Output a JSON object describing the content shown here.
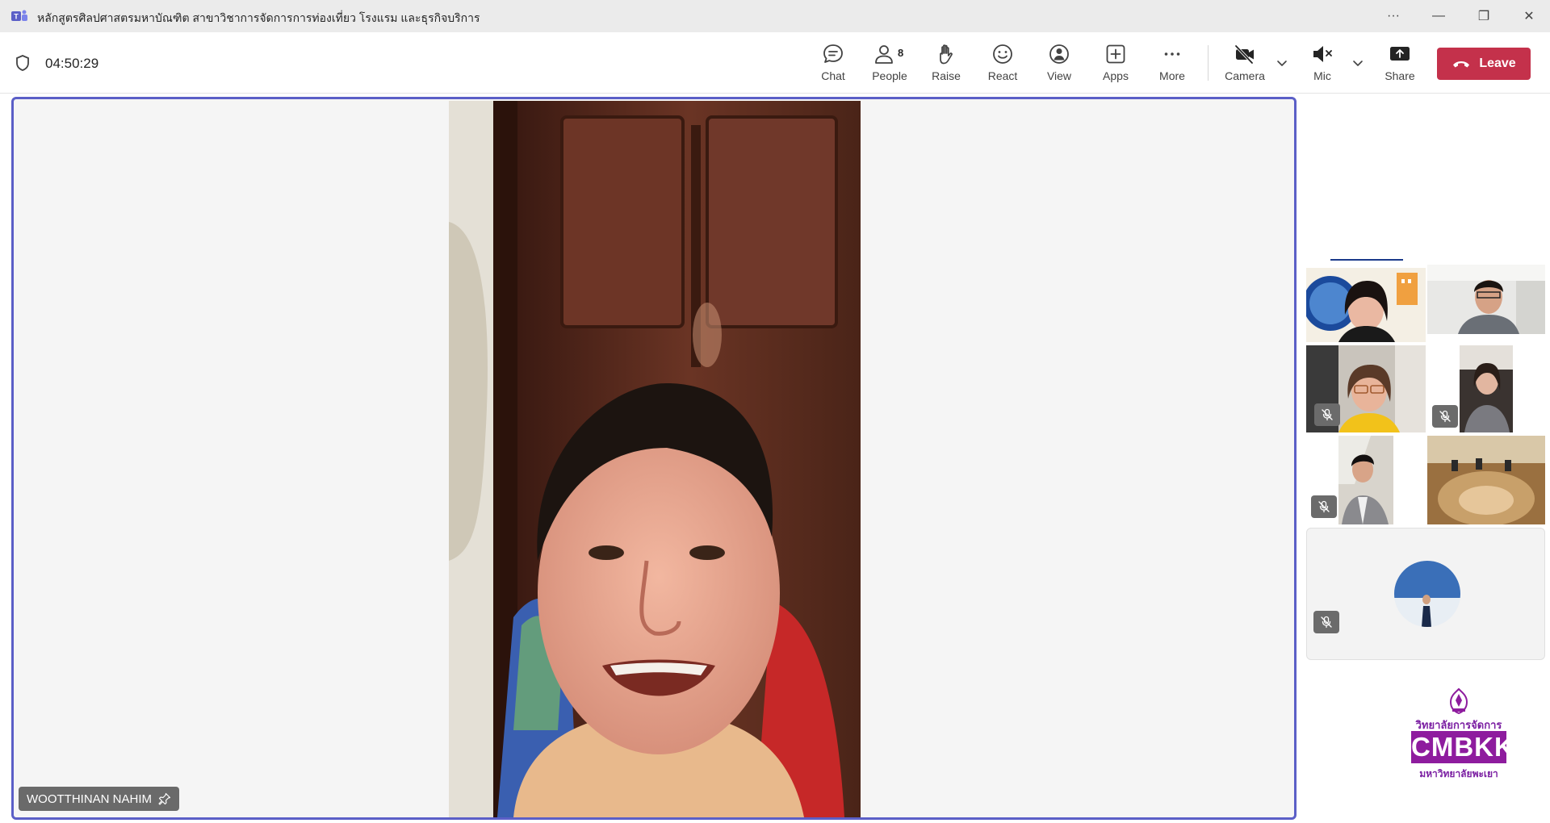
{
  "window": {
    "title": "หลักสูตรศิลปศาสตรมหาบัณฑิต สาขาวิชาการจัดการการท่องเที่ยว โรงแรม และธุรกิจบริการ",
    "more_label": "···",
    "minimize_label": "—",
    "restore_label": "❐",
    "close_label": "✕"
  },
  "toolbar": {
    "timer": "04:50:29",
    "chat_label": "Chat",
    "people_label": "People",
    "people_count": "8",
    "raise_label": "Raise",
    "react_label": "React",
    "view_label": "View",
    "apps_label": "Apps",
    "more_label": "More",
    "camera_label": "Camera",
    "mic_label": "Mic",
    "share_label": "Share",
    "leave_label": "Leave"
  },
  "stage": {
    "speaker_name": "WOOTTHINAN NAHIM"
  },
  "logo": {
    "line1": "วิทยาลัยการจัดการ",
    "brand": "CMBKK",
    "line2": "มหาวิทยาลัยพะเยา"
  },
  "colors": {
    "accent": "#5b5fc7",
    "leave": "#c4314b",
    "logo_purple": "#8e1c9e"
  }
}
